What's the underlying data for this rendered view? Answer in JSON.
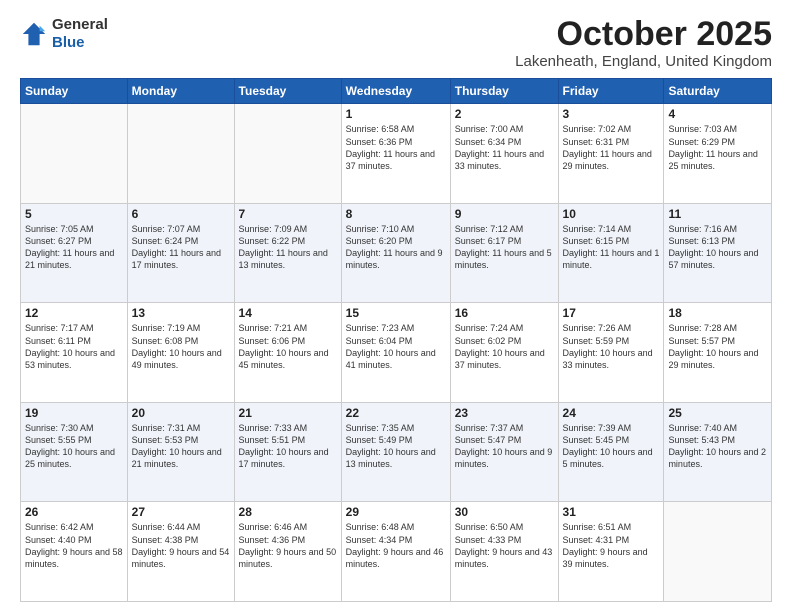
{
  "header": {
    "logo_general": "General",
    "logo_blue": "Blue",
    "month_title": "October 2025",
    "location": "Lakenheath, England, United Kingdom"
  },
  "weekdays": [
    "Sunday",
    "Monday",
    "Tuesday",
    "Wednesday",
    "Thursday",
    "Friday",
    "Saturday"
  ],
  "weeks": [
    [
      {
        "day": "",
        "text": ""
      },
      {
        "day": "",
        "text": ""
      },
      {
        "day": "",
        "text": ""
      },
      {
        "day": "1",
        "text": "Sunrise: 6:58 AM\nSunset: 6:36 PM\nDaylight: 11 hours\nand 37 minutes."
      },
      {
        "day": "2",
        "text": "Sunrise: 7:00 AM\nSunset: 6:34 PM\nDaylight: 11 hours\nand 33 minutes."
      },
      {
        "day": "3",
        "text": "Sunrise: 7:02 AM\nSunset: 6:31 PM\nDaylight: 11 hours\nand 29 minutes."
      },
      {
        "day": "4",
        "text": "Sunrise: 7:03 AM\nSunset: 6:29 PM\nDaylight: 11 hours\nand 25 minutes."
      }
    ],
    [
      {
        "day": "5",
        "text": "Sunrise: 7:05 AM\nSunset: 6:27 PM\nDaylight: 11 hours\nand 21 minutes."
      },
      {
        "day": "6",
        "text": "Sunrise: 7:07 AM\nSunset: 6:24 PM\nDaylight: 11 hours\nand 17 minutes."
      },
      {
        "day": "7",
        "text": "Sunrise: 7:09 AM\nSunset: 6:22 PM\nDaylight: 11 hours\nand 13 minutes."
      },
      {
        "day": "8",
        "text": "Sunrise: 7:10 AM\nSunset: 6:20 PM\nDaylight: 11 hours\nand 9 minutes."
      },
      {
        "day": "9",
        "text": "Sunrise: 7:12 AM\nSunset: 6:17 PM\nDaylight: 11 hours\nand 5 minutes."
      },
      {
        "day": "10",
        "text": "Sunrise: 7:14 AM\nSunset: 6:15 PM\nDaylight: 11 hours\nand 1 minute."
      },
      {
        "day": "11",
        "text": "Sunrise: 7:16 AM\nSunset: 6:13 PM\nDaylight: 10 hours\nand 57 minutes."
      }
    ],
    [
      {
        "day": "12",
        "text": "Sunrise: 7:17 AM\nSunset: 6:11 PM\nDaylight: 10 hours\nand 53 minutes."
      },
      {
        "day": "13",
        "text": "Sunrise: 7:19 AM\nSunset: 6:08 PM\nDaylight: 10 hours\nand 49 minutes."
      },
      {
        "day": "14",
        "text": "Sunrise: 7:21 AM\nSunset: 6:06 PM\nDaylight: 10 hours\nand 45 minutes."
      },
      {
        "day": "15",
        "text": "Sunrise: 7:23 AM\nSunset: 6:04 PM\nDaylight: 10 hours\nand 41 minutes."
      },
      {
        "day": "16",
        "text": "Sunrise: 7:24 AM\nSunset: 6:02 PM\nDaylight: 10 hours\nand 37 minutes."
      },
      {
        "day": "17",
        "text": "Sunrise: 7:26 AM\nSunset: 5:59 PM\nDaylight: 10 hours\nand 33 minutes."
      },
      {
        "day": "18",
        "text": "Sunrise: 7:28 AM\nSunset: 5:57 PM\nDaylight: 10 hours\nand 29 minutes."
      }
    ],
    [
      {
        "day": "19",
        "text": "Sunrise: 7:30 AM\nSunset: 5:55 PM\nDaylight: 10 hours\nand 25 minutes."
      },
      {
        "day": "20",
        "text": "Sunrise: 7:31 AM\nSunset: 5:53 PM\nDaylight: 10 hours\nand 21 minutes."
      },
      {
        "day": "21",
        "text": "Sunrise: 7:33 AM\nSunset: 5:51 PM\nDaylight: 10 hours\nand 17 minutes."
      },
      {
        "day": "22",
        "text": "Sunrise: 7:35 AM\nSunset: 5:49 PM\nDaylight: 10 hours\nand 13 minutes."
      },
      {
        "day": "23",
        "text": "Sunrise: 7:37 AM\nSunset: 5:47 PM\nDaylight: 10 hours\nand 9 minutes."
      },
      {
        "day": "24",
        "text": "Sunrise: 7:39 AM\nSunset: 5:45 PM\nDaylight: 10 hours\nand 5 minutes."
      },
      {
        "day": "25",
        "text": "Sunrise: 7:40 AM\nSunset: 5:43 PM\nDaylight: 10 hours\nand 2 minutes."
      }
    ],
    [
      {
        "day": "26",
        "text": "Sunrise: 6:42 AM\nSunset: 4:40 PM\nDaylight: 9 hours\nand 58 minutes."
      },
      {
        "day": "27",
        "text": "Sunrise: 6:44 AM\nSunset: 4:38 PM\nDaylight: 9 hours\nand 54 minutes."
      },
      {
        "day": "28",
        "text": "Sunrise: 6:46 AM\nSunset: 4:36 PM\nDaylight: 9 hours\nand 50 minutes."
      },
      {
        "day": "29",
        "text": "Sunrise: 6:48 AM\nSunset: 4:34 PM\nDaylight: 9 hours\nand 46 minutes."
      },
      {
        "day": "30",
        "text": "Sunrise: 6:50 AM\nSunset: 4:33 PM\nDaylight: 9 hours\nand 43 minutes."
      },
      {
        "day": "31",
        "text": "Sunrise: 6:51 AM\nSunset: 4:31 PM\nDaylight: 9 hours\nand 39 minutes."
      },
      {
        "day": "",
        "text": ""
      }
    ]
  ]
}
